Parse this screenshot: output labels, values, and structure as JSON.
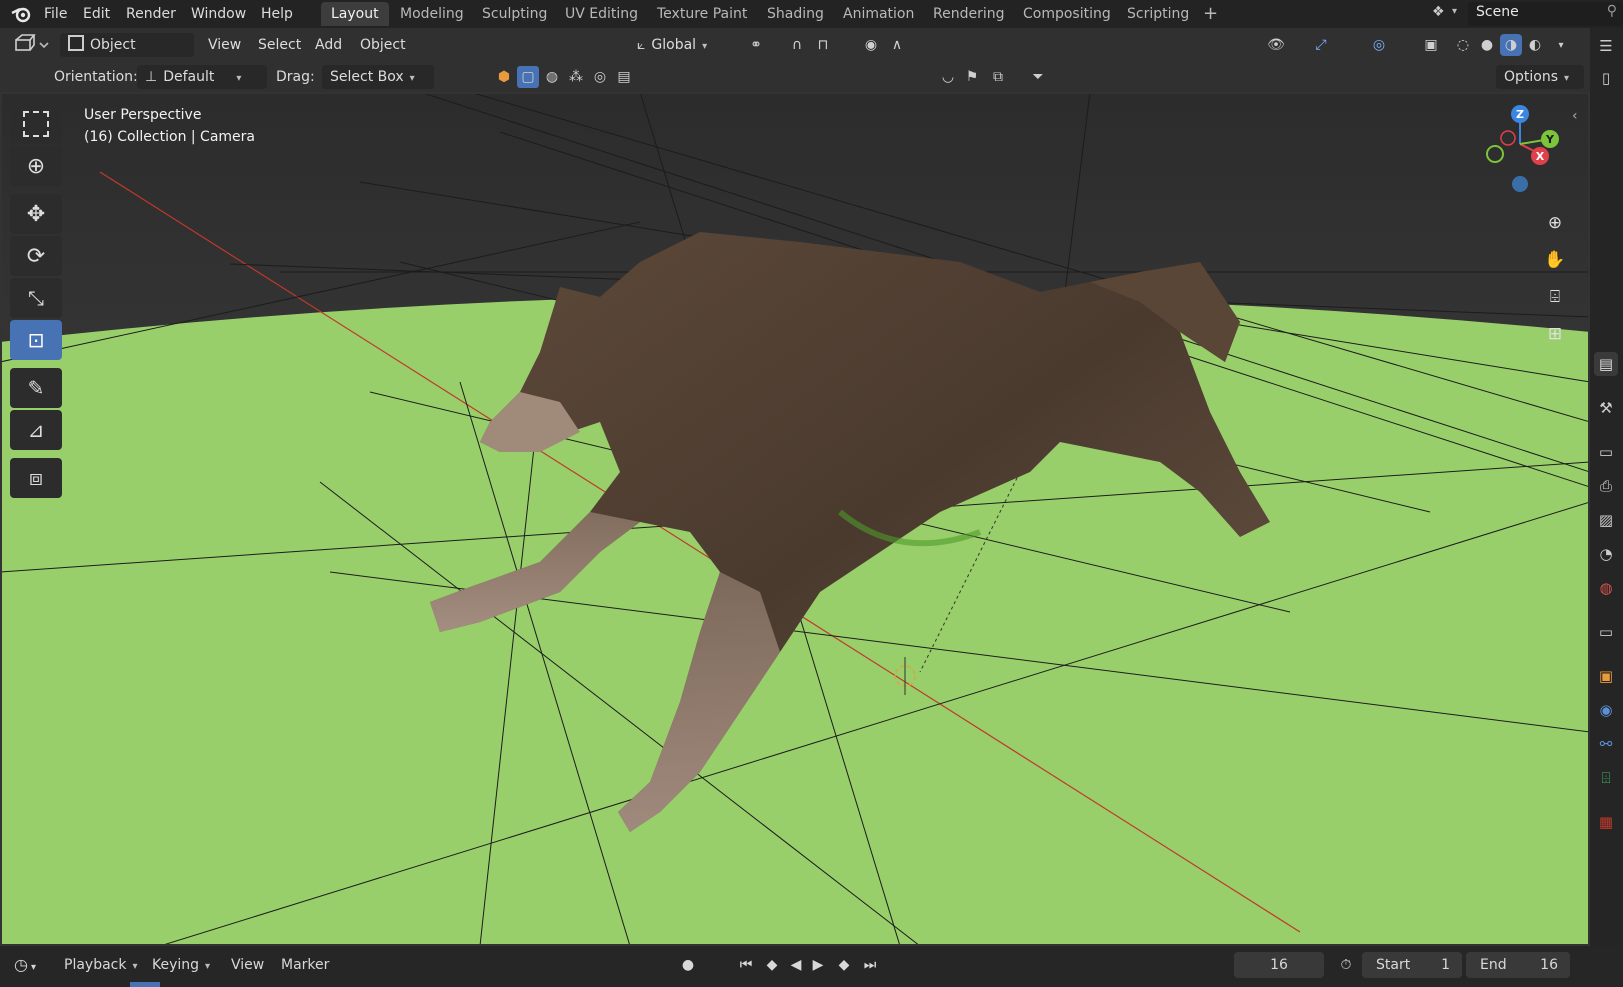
{
  "topbar": {
    "menus": [
      "File",
      "Edit",
      "Render",
      "Window",
      "Help"
    ],
    "workspaces": [
      "Layout",
      "Modeling",
      "Sculpting",
      "UV Editing",
      "Texture Paint",
      "Shading",
      "Animation",
      "Rendering",
      "Compositing",
      "Scripting"
    ],
    "active_workspace": "Layout",
    "add_tab": "+",
    "scene": "Scene"
  },
  "header": {
    "mode": "Object Mode",
    "menus": [
      "View",
      "Select",
      "Add",
      "Object"
    ],
    "transform_orientation": "Global",
    "options": "Options"
  },
  "tool_settings": {
    "orientation_label": "Orientation:",
    "orientation_value": "Default",
    "drag_label": "Drag:",
    "drag_value": "Select Box"
  },
  "viewport": {
    "perspective": "User Perspective",
    "context": "(16) Collection | Camera",
    "gizmo_axes": [
      "Z",
      "Y",
      "X"
    ],
    "ground_color": "#99cf6a",
    "sky_color": "#3a3a3a"
  },
  "timeline": {
    "menus": [
      "Playback",
      "Keying",
      "View",
      "Marker"
    ],
    "current_frame": "16",
    "start_label": "Start",
    "start_value": "1",
    "end_label": "End",
    "end_value": "16"
  },
  "colors": {
    "accent": "#4772b3",
    "x_axis": "#e0404a",
    "y_axis": "#7cc43a",
    "z_axis": "#3b86e0"
  }
}
